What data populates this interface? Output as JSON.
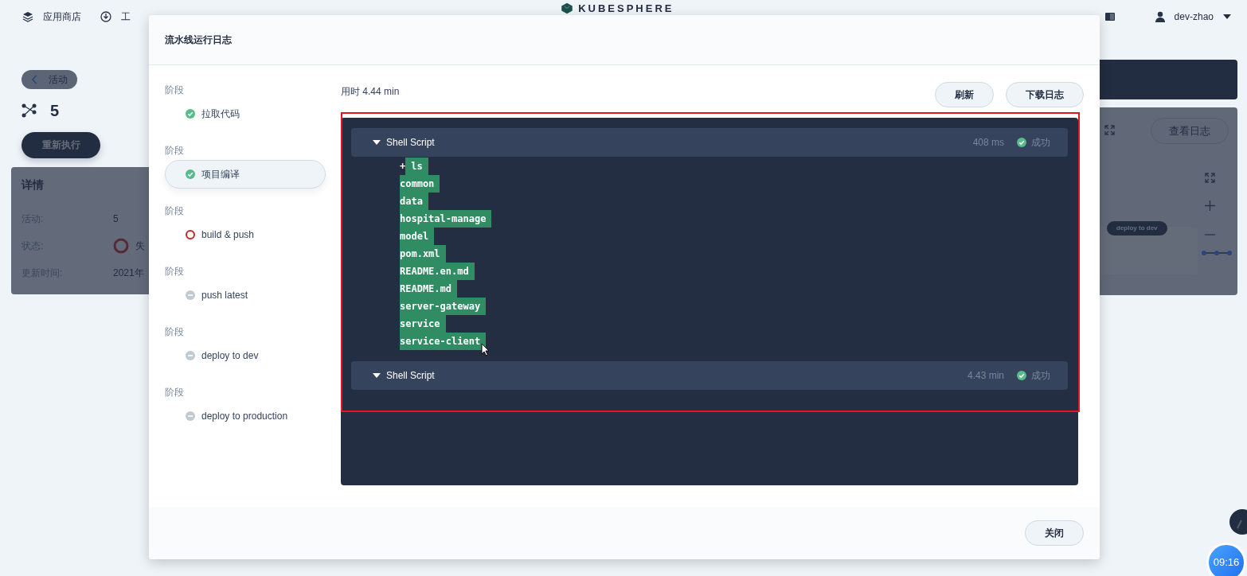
{
  "top_bar": {
    "items": [
      {
        "label": "应用商店"
      },
      {
        "label": "工"
      }
    ],
    "logo": "KUBESPHERE",
    "user": "dev-zhao"
  },
  "page": {
    "back": "活动",
    "run_number": "5",
    "rerun_button": "重新执行",
    "details": {
      "title": "详情",
      "rows": [
        {
          "kind": "text",
          "label": "活动:",
          "value": "5"
        },
        {
          "kind": "failed",
          "label": "状态:",
          "value": "失"
        },
        {
          "kind": "text",
          "label": "更新时间:",
          "value": "2021年"
        }
      ]
    },
    "view_log_button": "查看日志",
    "graph_node": "deploy to dev"
  },
  "modal": {
    "title": "流水线运行日志",
    "elapsed": "用时 4.44 min",
    "buttons": [
      "刷新",
      "下载日志"
    ],
    "close_button": "关闭",
    "stages": [
      {
        "heading": "阶段",
        "name": "拉取代码",
        "kind": "success",
        "selected": false
      },
      {
        "heading": "阶段",
        "name": "项目编译",
        "kind": "success",
        "selected": true
      },
      {
        "heading": "阶段",
        "name": "build & push",
        "kind": "failed",
        "selected": false
      },
      {
        "heading": "阶段",
        "name": "push latest",
        "kind": "pending",
        "selected": false
      },
      {
        "heading": "阶段",
        "name": "deploy to dev",
        "kind": "pending",
        "selected": false
      },
      {
        "heading": "阶段",
        "name": "deploy to production",
        "kind": "pending",
        "selected": false
      }
    ],
    "log_sections": [
      {
        "title": "Shell Script",
        "expanded": true,
        "duration": "408 ms",
        "kind": "success",
        "status_text": "成功",
        "lines": [
          {
            "prompt": "+",
            "text": "ls",
            "selected": true
          },
          {
            "text": "common",
            "selected": true
          },
          {
            "text": "data",
            "selected": true
          },
          {
            "text": "hospital-manage",
            "selected": true
          },
          {
            "text": "model",
            "selected": true
          },
          {
            "text": "pom.xml",
            "selected": true
          },
          {
            "text": "README.en.md",
            "selected": true
          },
          {
            "text": "README.md",
            "selected": true
          },
          {
            "text": "server-gateway",
            "selected": true
          },
          {
            "text": "service",
            "selected": true
          },
          {
            "text": "service-client",
            "selected": true
          }
        ]
      },
      {
        "title": "Shell Script",
        "expanded": true,
        "duration": "4.43 min",
        "kind": "success",
        "status_text": "成功"
      }
    ]
  },
  "clock": "09:16"
}
